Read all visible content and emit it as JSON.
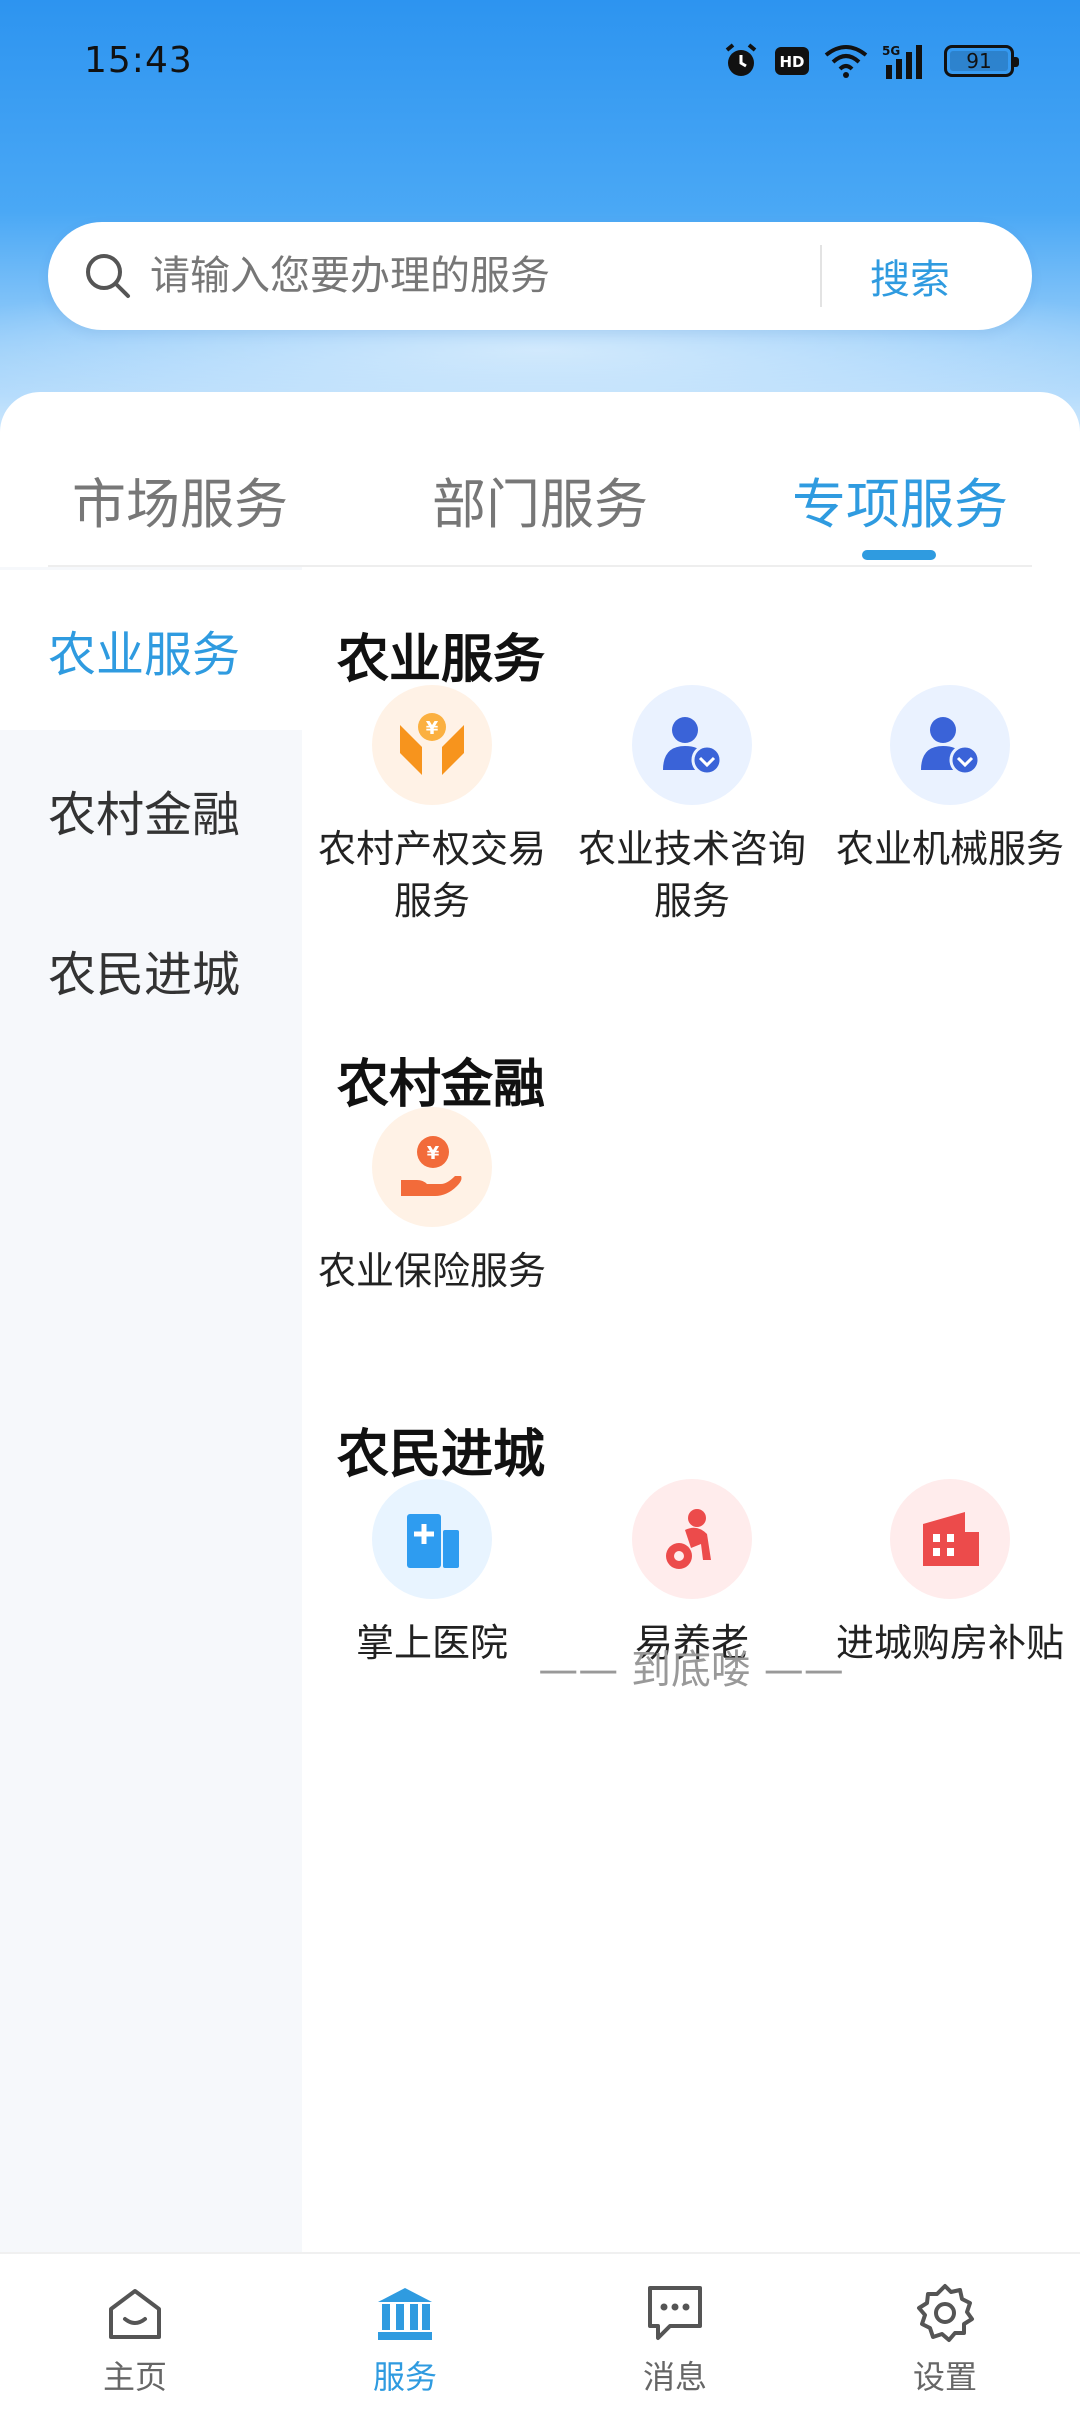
{
  "status_bar": {
    "time": "15:43",
    "battery_level": "91",
    "network": "5G",
    "icons": [
      "alarm-icon",
      "hd-icon",
      "wifi-icon",
      "signal-icon",
      "battery-icon"
    ]
  },
  "search": {
    "placeholder": "请输入您要办理的服务",
    "button_label": "搜索"
  },
  "tabs": [
    {
      "label": "市场服务",
      "active": false
    },
    {
      "label": "部门服务",
      "active": false
    },
    {
      "label": "专项服务",
      "active": true
    }
  ],
  "sidebar": {
    "items": [
      {
        "label": "农业服务",
        "active": true
      },
      {
        "label": "农村金融",
        "active": false
      },
      {
        "label": "农民进城",
        "active": false
      }
    ]
  },
  "sections": [
    {
      "title": "农业服务",
      "services": [
        {
          "label": "农村产权交易服务",
          "icon": "property-exchange-icon"
        },
        {
          "label": "农业技术咨询服务",
          "icon": "user-consult-icon"
        },
        {
          "label": "农业机械服务",
          "icon": "user-machinery-icon"
        }
      ]
    },
    {
      "title": "农村金融",
      "services": [
        {
          "label": "农业保险服务",
          "icon": "insurance-coin-hand-icon"
        }
      ]
    },
    {
      "title": "农民进城",
      "services": [
        {
          "label": "掌上医院",
          "icon": "hospital-icon"
        },
        {
          "label": "易养老",
          "icon": "elderly-care-icon"
        },
        {
          "label": "进城购房补贴",
          "icon": "building-icon"
        }
      ]
    }
  ],
  "end_text": "—— 到底喽 ——",
  "bottom_nav": [
    {
      "label": "主页",
      "icon": "home-icon",
      "active": false
    },
    {
      "label": "服务",
      "icon": "bank-icon",
      "active": true
    },
    {
      "label": "消息",
      "icon": "message-icon",
      "active": false
    },
    {
      "label": "设置",
      "icon": "gear-icon",
      "active": false
    }
  ],
  "colors": {
    "accent": "#2f9be0",
    "hero_top": "#2d94f0",
    "sidebar_bg": "#f6f8fb"
  }
}
